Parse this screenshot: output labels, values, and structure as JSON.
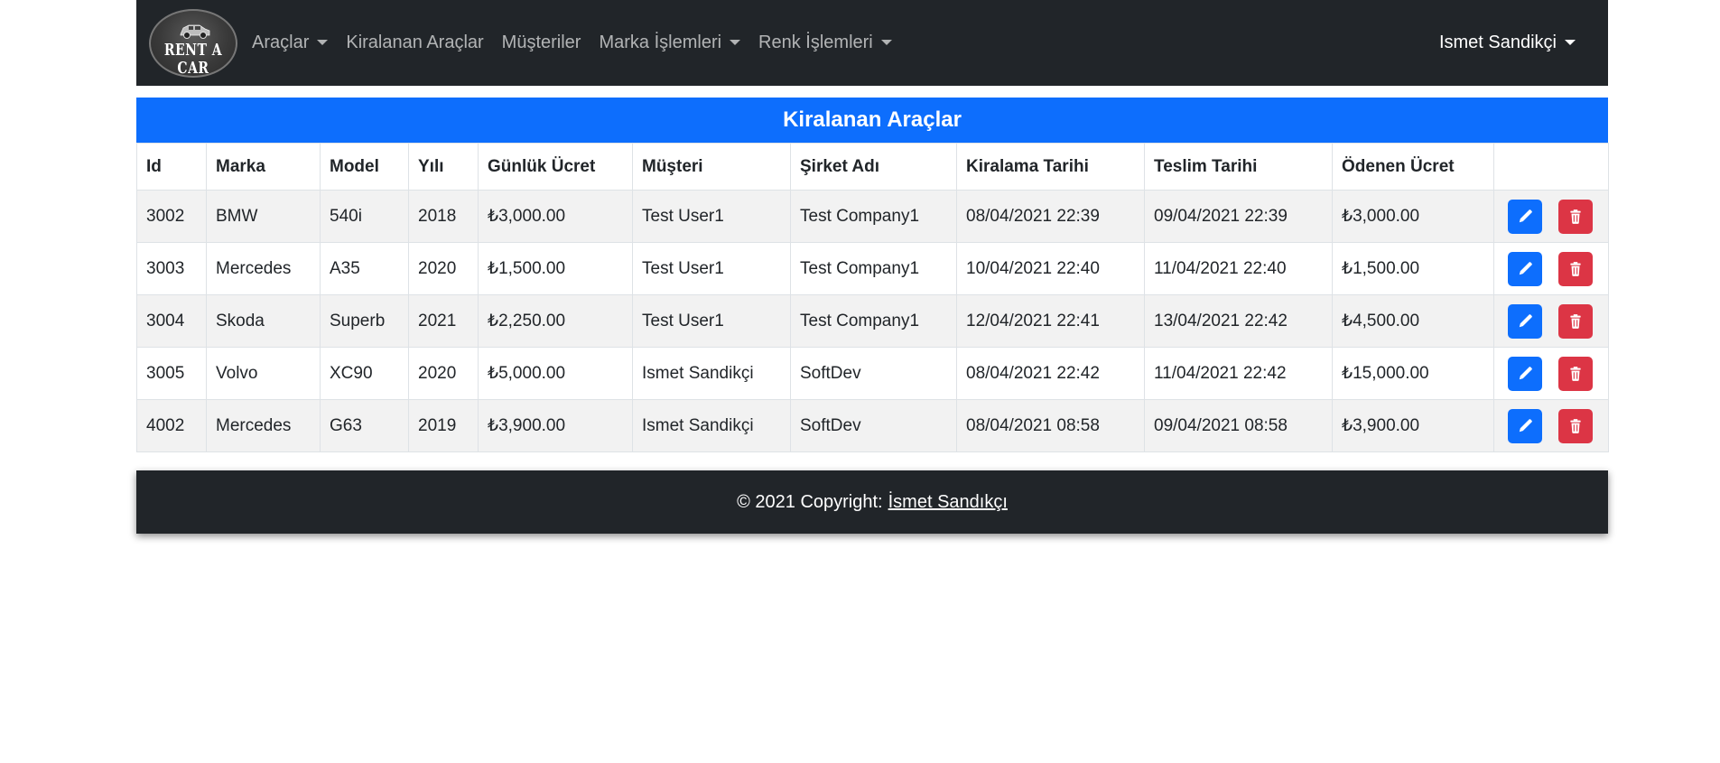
{
  "navbar": {
    "brand_text": "RENT A CAR",
    "brand_icon": "car-logo",
    "links": [
      {
        "label": "Araçlar",
        "dropdown": true
      },
      {
        "label": "Kiralanan Araçlar",
        "dropdown": false
      },
      {
        "label": "Müşteriler",
        "dropdown": false
      },
      {
        "label": "Marka İşlemleri",
        "dropdown": true
      },
      {
        "label": "Renk İşlemleri",
        "dropdown": true
      }
    ],
    "user": "Ismet Sandikçi"
  },
  "page": {
    "title": "Kiralanan Araçlar"
  },
  "table": {
    "headers": [
      "Id",
      "Marka",
      "Model",
      "Yılı",
      "Günlük Ücret",
      "Müşteri",
      "Şirket Adı",
      "Kiralama Tarihi",
      "Teslim Tarihi",
      "Ödenen Ücret",
      ""
    ],
    "rows": [
      [
        "3002",
        "BMW",
        "540i",
        "2018",
        "₺3,000.00",
        "Test User1",
        "Test Company1",
        "08/04/2021 22:39",
        "09/04/2021 22:39",
        "₺3,000.00"
      ],
      [
        "3003",
        "Mercedes",
        "A35",
        "2020",
        "₺1,500.00",
        "Test User1",
        "Test Company1",
        "10/04/2021 22:40",
        "11/04/2021 22:40",
        "₺1,500.00"
      ],
      [
        "3004",
        "Skoda",
        "Superb",
        "2021",
        "₺2,250.00",
        "Test User1",
        "Test Company1",
        "12/04/2021 22:41",
        "13/04/2021 22:42",
        "₺4,500.00"
      ],
      [
        "3005",
        "Volvo",
        "XC90",
        "2020",
        "₺5,000.00",
        "Ismet Sandikçi",
        "SoftDev",
        "08/04/2021 22:42",
        "11/04/2021 22:42",
        "₺15,000.00"
      ],
      [
        "4002",
        "Mercedes",
        "G63",
        "2019",
        "₺3,900.00",
        "Ismet Sandikçi",
        "SoftDev",
        "08/04/2021 08:58",
        "09/04/2021 08:58",
        "₺3,900.00"
      ]
    ],
    "actions": {
      "edit_icon": "pencil-icon",
      "delete_icon": "trash-icon"
    }
  },
  "footer": {
    "copyright": "© 2021 Copyright:",
    "author_link": "İsmet Sandıkçı"
  },
  "colors": {
    "navbar_bg": "#212529",
    "primary": "#0d6efd",
    "danger": "#dc3545",
    "stripe": "#f2f2f2"
  }
}
